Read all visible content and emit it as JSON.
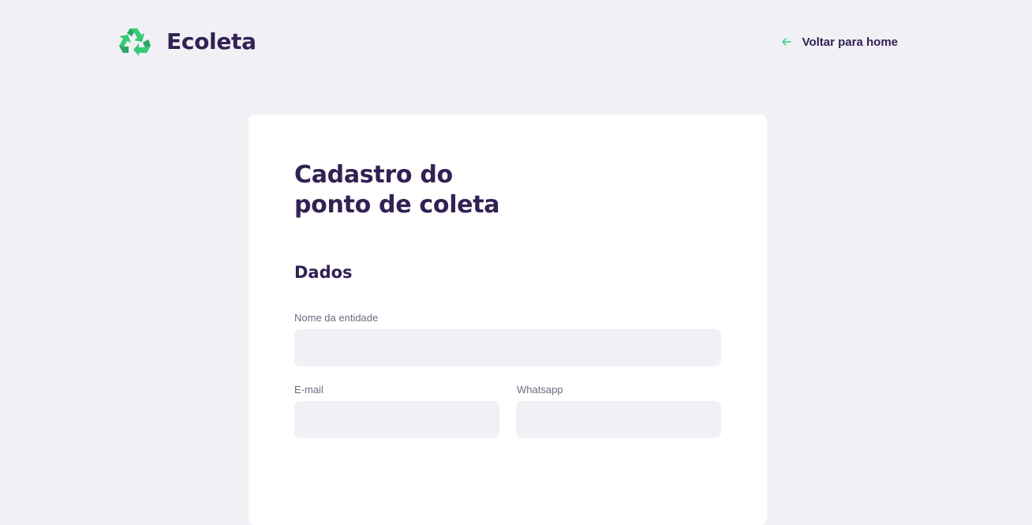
{
  "header": {
    "app_name": "Ecoleta",
    "logo_icon": "recycle-icon",
    "back_icon": "arrow-left-icon",
    "back_label": "Voltar para home"
  },
  "colors": {
    "background": "#F0F0F5",
    "card": "#FFFFFF",
    "title": "#322153",
    "label": "#6C6C80",
    "accent": "#34CB79"
  },
  "form": {
    "title_line1": "Cadastro do",
    "title_line2": "ponto de coleta",
    "section_title": "Dados",
    "fields": {
      "name": {
        "label": "Nome da entidade",
        "value": ""
      },
      "email": {
        "label": "E-mail",
        "value": ""
      },
      "whatsapp": {
        "label": "Whatsapp",
        "value": ""
      }
    }
  }
}
